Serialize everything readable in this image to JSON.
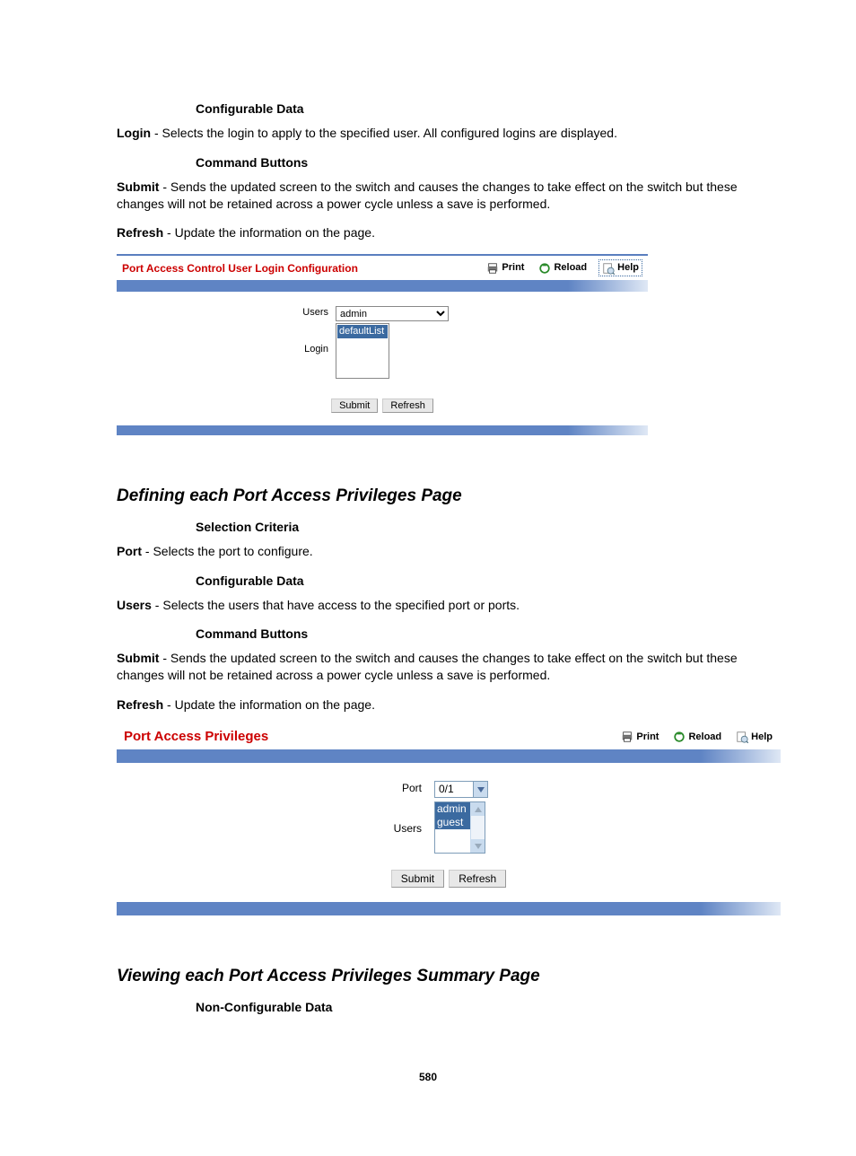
{
  "sec1": {
    "h_conf": "Configurable Data",
    "login_def": "<b>Login</b> - Selects the login to apply to the specified user. All configured logins are displayed.",
    "h_cmd": "Command Buttons",
    "submit_def": "<b>Submit</b> - Sends the updated screen to the switch and causes the changes to take effect on the switch but these changes will not be retained across a power cycle unless a save is performed.",
    "refresh_def": "<b>Refresh</b> - Update the information on the page."
  },
  "panel1": {
    "title": "Port Access Control User Login Configuration",
    "print": "Print",
    "reload": "Reload",
    "help": "Help",
    "lbl_users": "Users",
    "lbl_login": "Login",
    "users_value": "admin",
    "login_option": "defaultList",
    "btn_submit": "Submit",
    "btn_refresh": "Refresh"
  },
  "title2": "Defining each Port Access Privileges Page",
  "sec2": {
    "h_sel": "Selection Criteria",
    "port_def": "<b>Port</b> - Selects the port to configure.",
    "h_conf": "Configurable Data",
    "users_def": "<b>Users</b> - Selects the users that have access to the specified port or ports.",
    "h_cmd": "Command Buttons",
    "submit_def": "<b>Submit</b> - Sends the updated screen to the switch and causes the changes to take effect on the switch but these changes will not be retained across a power cycle unless a save is performed.",
    "refresh_def": "<b>Refresh</b> - Update the information on the page."
  },
  "panel2": {
    "title": "Port Access Privileges",
    "print": "Print",
    "reload": "Reload",
    "help": "Help",
    "lbl_port": "Port",
    "lbl_users": "Users",
    "port_value": "0/1",
    "user_opt1": "admin",
    "user_opt2": "guest",
    "btn_submit": "Submit",
    "btn_refresh": "Refresh"
  },
  "title3": "Viewing each Port Access Privileges Summary Page",
  "sec3": {
    "h_nonconf": "Non-Configurable Data"
  },
  "pagenum": "580"
}
